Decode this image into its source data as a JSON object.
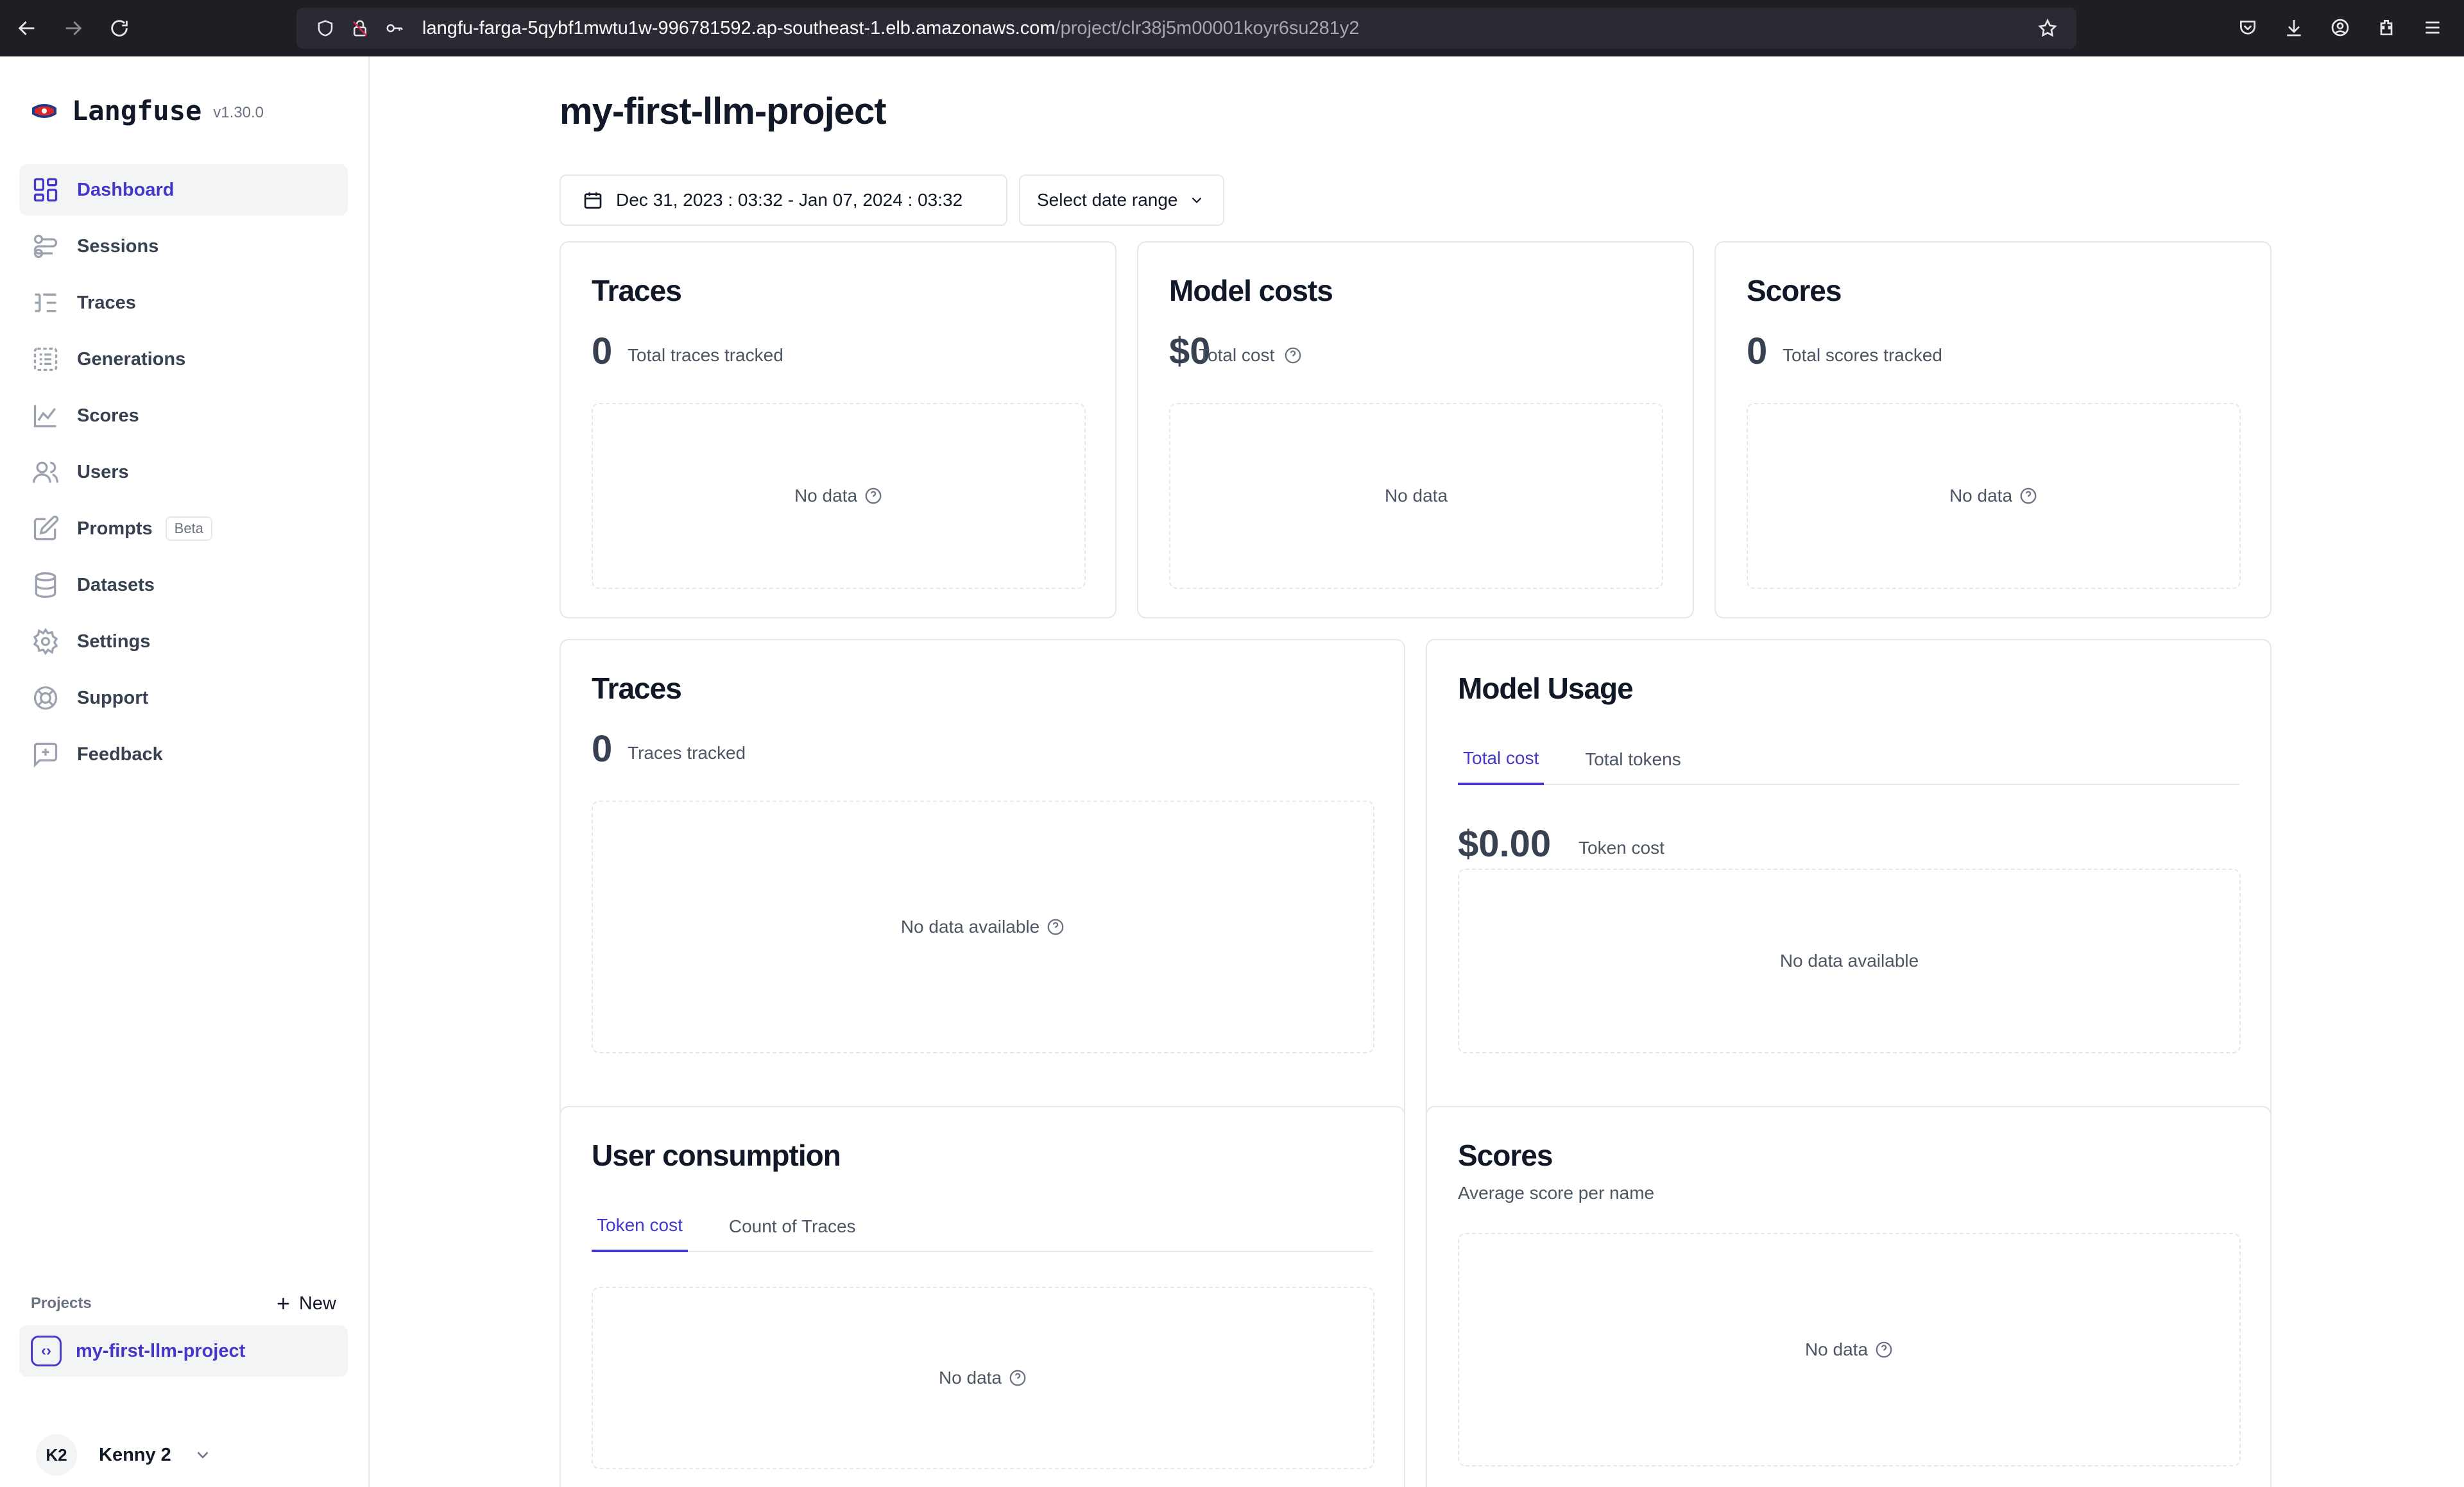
{
  "browser": {
    "url_host": "langfu-farga-5qybf1mwtu1w-996781592.ap-southeast-1.elb.amazonaws.com",
    "url_path": "/project/clr38j5m00001koyr6su281y2"
  },
  "brand": {
    "name": "Langfuse",
    "version": "v1.30.0"
  },
  "sidebar": {
    "items": [
      {
        "label": "Dashboard",
        "icon": "dashboard-icon",
        "active": true
      },
      {
        "label": "Sessions",
        "icon": "sessions-icon"
      },
      {
        "label": "Traces",
        "icon": "traces-icon"
      },
      {
        "label": "Generations",
        "icon": "generations-icon"
      },
      {
        "label": "Scores",
        "icon": "scores-icon"
      },
      {
        "label": "Users",
        "icon": "users-icon"
      },
      {
        "label": "Prompts",
        "icon": "prompts-icon",
        "badge": "Beta"
      },
      {
        "label": "Datasets",
        "icon": "datasets-icon"
      },
      {
        "label": "Settings",
        "icon": "settings-icon"
      },
      {
        "label": "Support",
        "icon": "support-icon"
      },
      {
        "label": "Feedback",
        "icon": "feedback-icon"
      }
    ],
    "projects_label": "Projects",
    "new_label": "New",
    "project_name": "my-first-llm-project",
    "user_initials": "K2",
    "user_name": "Kenny 2"
  },
  "main": {
    "title": "my-first-llm-project",
    "date_range": "Dec 31, 2023 : 03:32 - Jan 07, 2024 : 03:32",
    "select_range_label": "Select date range",
    "cards": {
      "traces_top": {
        "title": "Traces",
        "value": "0",
        "sub": "Total traces tracked",
        "empty": "No data"
      },
      "model_costs": {
        "title": "Model costs",
        "value": "$0",
        "sub": "Total cost",
        "empty": "No data"
      },
      "scores_top": {
        "title": "Scores",
        "value": "0",
        "sub": "Total scores tracked",
        "empty": "No data"
      },
      "traces_mid": {
        "title": "Traces",
        "value": "0",
        "sub": "Traces tracked",
        "empty": "No data available"
      },
      "model_usage": {
        "title": "Model Usage",
        "tabs": [
          "Total cost",
          "Total tokens"
        ],
        "value": "$0.00",
        "sub": "Token cost",
        "empty": "No data available"
      },
      "user_consumption": {
        "title": "User consumption",
        "tabs": [
          "Token cost",
          "Count of Traces"
        ],
        "empty": "No data"
      },
      "scores_bottom": {
        "title": "Scores",
        "desc": "Average score per name",
        "empty": "No data"
      }
    }
  },
  "colors": {
    "accent": "#4338ca",
    "border": "#e5e7eb",
    "chrome": "#1f1e25"
  }
}
